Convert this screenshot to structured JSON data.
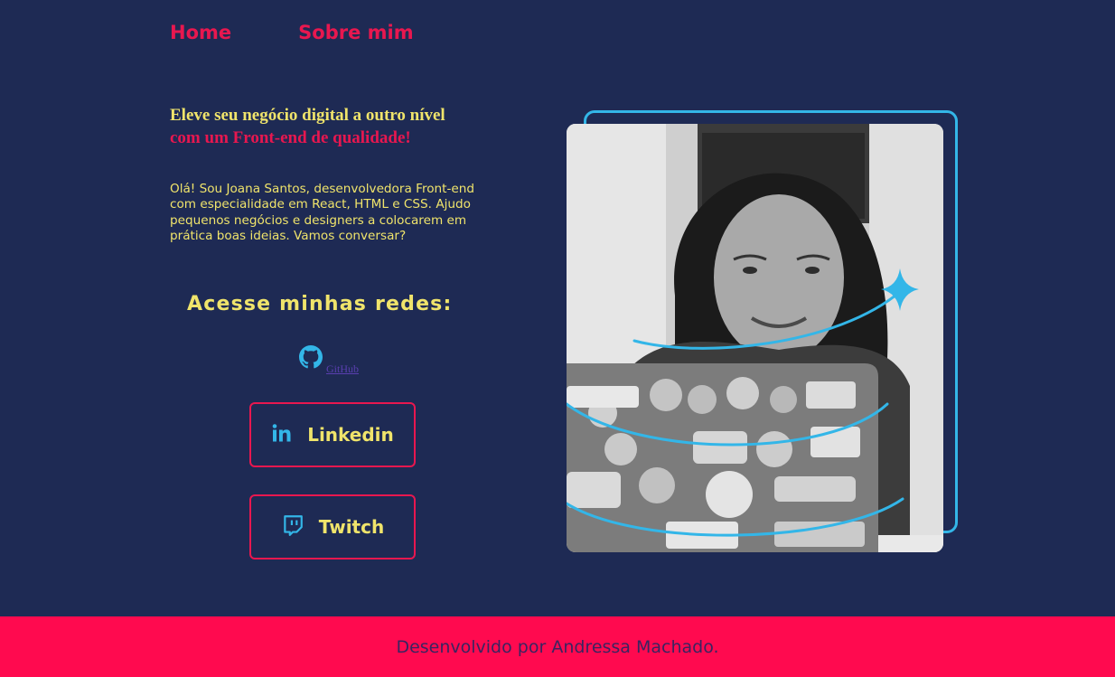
{
  "nav": {
    "items": [
      {
        "label": "Home"
      },
      {
        "label": "Sobre mim"
      }
    ]
  },
  "hero": {
    "headline_line1": "Eleve seu negócio digital a outro nível",
    "headline_line2": "com um Front-end de qualidade!",
    "intro": "Olá! Sou Joana Santos, desenvolvedora Front-end com especialidade em React, HTML e CSS. Ajudo pequenos negócios e designers a colocarem em prática boas ideias. Vamos conversar?",
    "photo_alt": "Joana Santos"
  },
  "social": {
    "title": "Acesse minhas redes:",
    "github_label": "GitHub",
    "github_icon": "github-icon",
    "linkedin_label": "Linkedin",
    "linkedin_icon": "linkedin-icon",
    "twitch_label": "Twitch",
    "twitch_icon": "twitch-icon"
  },
  "footer": {
    "text": "Desenvolvido por Andressa Machado."
  },
  "colors": {
    "background": "#1e2a54",
    "accent_pink": "#e8174f",
    "accent_yellow": "#f0e46b",
    "accent_cyan": "#33b6e8",
    "footer_bg": "#ff0a4f"
  }
}
